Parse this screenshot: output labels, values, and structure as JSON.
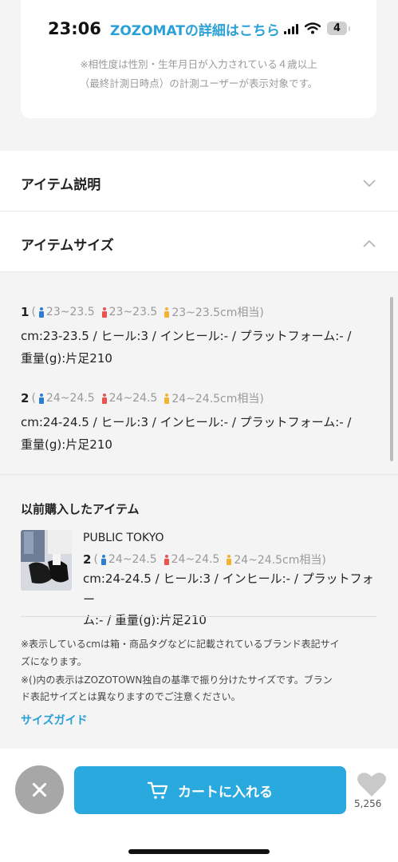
{
  "status_bar": {
    "time": "23:06",
    "battery": "4"
  },
  "zozomat": {
    "link": "ZOZOMATの詳細はこちら",
    "note_line1": "※相性度は性別・生年月日が入力されている４歳以上",
    "note_line2": "（最終計測日時点）の計測ユーザーが表示対象です。"
  },
  "sections": {
    "description_title": "アイテム説明",
    "size_title": "アイテムサイズ"
  },
  "sizes": [
    {
      "number": "1",
      "open": "(",
      "male": "23~23.5",
      "female": "23~23.5",
      "kids": "23~23.5cm相当)",
      "desc_line1": "cm:23-23.5 / ヒール:3 / インヒール:- / プラットフォーム:- /",
      "desc_line2": "重量(g):片足210"
    },
    {
      "number": "2",
      "open": "(",
      "male": "24~24.5",
      "female": "24~24.5",
      "kids": "24~24.5cm相当)",
      "desc_line1": "cm:24-24.5 / ヒール:3 / インヒール:- / プラットフォーム:- /",
      "desc_line2": "重量(g):片足210"
    }
  ],
  "previous": {
    "title": "以前購入したアイテム",
    "brand": "PUBLIC TOKYO",
    "number": "2",
    "open": "(",
    "male": "24~24.5",
    "female": "24~24.5",
    "kids": "24~24.5cm相当)",
    "desc_line1": "cm:24-24.5 / ヒール:3 / インヒール:- / プラットフォー",
    "desc_line2": "ム:- / 重量(g):片足210"
  },
  "footnotes": {
    "line1": "※表示しているcmは箱・商品タグなどに記載されているブランド表記サイ",
    "line2": "ズになります。",
    "line3": "※()内の表示はZOZOTOWN独自の基準で振り分けたサイズです。ブラン",
    "line4": "ド表記サイズとは異なりますのでご注意ください。",
    "size_guide": "サイズガイド"
  },
  "bottom": {
    "cart_label": "カートに入れる",
    "fav_count": "5,256"
  },
  "colors": {
    "accent": "#2aa9de",
    "link": "#2aa1d6",
    "male_icon": "#2a7fd4",
    "female_icon": "#e8554e",
    "kids_icon": "#f2b233"
  }
}
